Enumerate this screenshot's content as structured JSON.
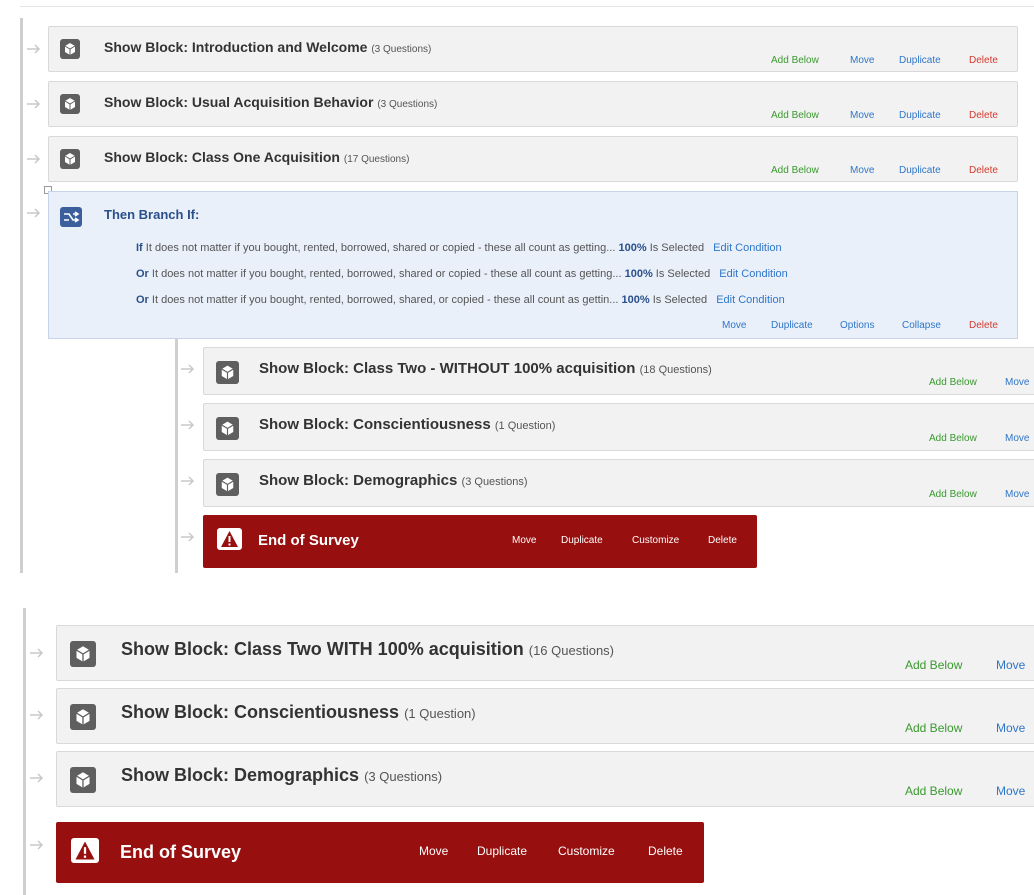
{
  "top": {
    "blocks": [
      {
        "title": "Show Block: Introduction and Welcome",
        "count": "(3 Questions)"
      },
      {
        "title": "Show Block: Usual Acquisition Behavior",
        "count": "(3 Questions)"
      },
      {
        "title": "Show Block: Class One Acquisition",
        "count": "(17 Questions)"
      }
    ],
    "block_actions": {
      "add_below": "Add Below",
      "move": "Move",
      "duplicate": "Duplicate",
      "delete": "Delete"
    },
    "branch": {
      "title": "Then Branch If:",
      "conditions": [
        {
          "conj": "If",
          "text": "It does not matter if you bought, rented, borrowed, shared or copied - these all count as getting...",
          "value": "100%",
          "op": "Is Selected",
          "edit": "Edit Condition"
        },
        {
          "conj": "Or",
          "text": "It does not matter if you bought, rented, borrowed, shared or copied - these all count as getting...",
          "value": "100%",
          "op": "Is Selected",
          "edit": "Edit Condition"
        },
        {
          "conj": "Or",
          "text": "It does not matter if you bought, rented, borrowed, shared, or copied - these all count as gettin...",
          "value": "100%",
          "op": "Is Selected",
          "edit": "Edit Condition"
        }
      ],
      "actions": {
        "move": "Move",
        "duplicate": "Duplicate",
        "options": "Options",
        "collapse": "Collapse",
        "delete": "Delete"
      }
    },
    "nested": [
      {
        "title": "Show Block: Class Two - WITHOUT 100% acquisition",
        "count": "(18 Questions)"
      },
      {
        "title": "Show Block: Conscientiousness",
        "count": "(1 Question)"
      },
      {
        "title": "Show Block: Demographics",
        "count": "(3 Questions)"
      }
    ],
    "nested_actions": {
      "add_below": "Add Below",
      "move": "Move"
    },
    "end": {
      "title": "End of Survey",
      "move": "Move",
      "duplicate": "Duplicate",
      "customize": "Customize",
      "delete": "Delete"
    }
  },
  "bottom": {
    "blocks": [
      {
        "title": "Show Block: Class Two WITH 100% acquisition",
        "count": "(16 Questions)"
      },
      {
        "title": "Show Block: Conscientiousness",
        "count": "(1 Question)"
      },
      {
        "title": "Show Block: Demographics",
        "count": "(3 Questions)"
      }
    ],
    "actions": {
      "add_below": "Add Below",
      "move": "Move"
    },
    "end": {
      "title": "End of Survey",
      "move": "Move",
      "duplicate": "Duplicate",
      "customize": "Customize",
      "delete": "Delete"
    }
  },
  "colors": {
    "end_bg": "#970f0f",
    "branch_bg": "#e9f0fa",
    "branch_icon": "#3b5f9c",
    "add_below": "#3a9a2f",
    "link": "#2f76c8",
    "delete": "#d33a2c"
  },
  "icons": [
    "block-icon",
    "branch-icon",
    "warning-icon",
    "arrow-right-icon",
    "collapse-toggle-icon"
  ]
}
